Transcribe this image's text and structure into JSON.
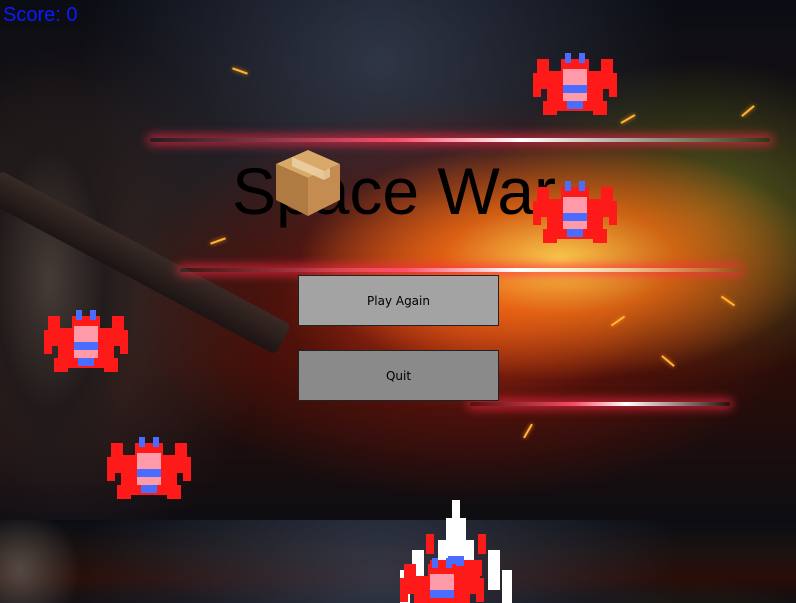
{
  "hud": {
    "score_label": "Score: 0"
  },
  "menu": {
    "title": "Space War",
    "play_again_label": "Play Again",
    "quit_label": "Quit"
  },
  "icons": {
    "title_overlay": "package-box-icon",
    "enemy": "alien-invader-icon",
    "player": "player-spaceship-icon"
  },
  "colors": {
    "score_text": "#0a1cff",
    "title_text": "#000000",
    "play_again_bg": "#a3a3a3",
    "quit_bg": "#8a8a8a",
    "alien_red": "#ff1a1a",
    "alien_pink": "#ff9aa8",
    "alien_blue": "#4a6cff"
  }
}
